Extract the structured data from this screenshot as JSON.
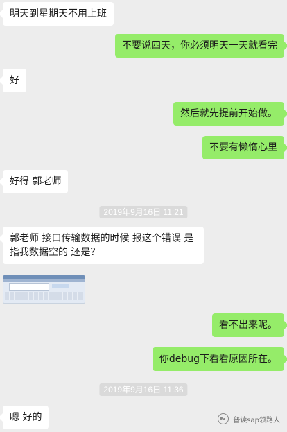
{
  "messages": [
    {
      "side": "left",
      "text": "明天到星期天不用上班"
    },
    {
      "side": "right",
      "text": "不要说四天，你必须明天一天就看完"
    },
    {
      "side": "left",
      "text": "好"
    },
    {
      "side": "right",
      "text": "然后就先提前开始做。"
    },
    {
      "side": "right",
      "text": "不要有懒惰心里"
    },
    {
      "side": "left",
      "text": "好得 郭老师"
    },
    {
      "side": "left",
      "text": "郭老师 接口传输数据的时候  报这个错误  是指我数据空的 还是？"
    },
    {
      "side": "right",
      "text": "看不出来呢。"
    },
    {
      "side": "right",
      "text": "你debug下看看原因所在。"
    },
    {
      "side": "left",
      "text": "嗯 好的"
    }
  ],
  "timestamps": [
    "2019年9月16日 11:21",
    "2019年9月16日 11:36"
  ],
  "image_message": {
    "icon": "screenshot-thumbnail"
  },
  "colors": {
    "background": "#ededed",
    "sent_bubble": "#95ec69",
    "received_bubble": "#ffffff",
    "timestamp_bg": "#dadada"
  },
  "watermark": {
    "icon": "wechat-icon",
    "text": "普读sap领路人"
  }
}
